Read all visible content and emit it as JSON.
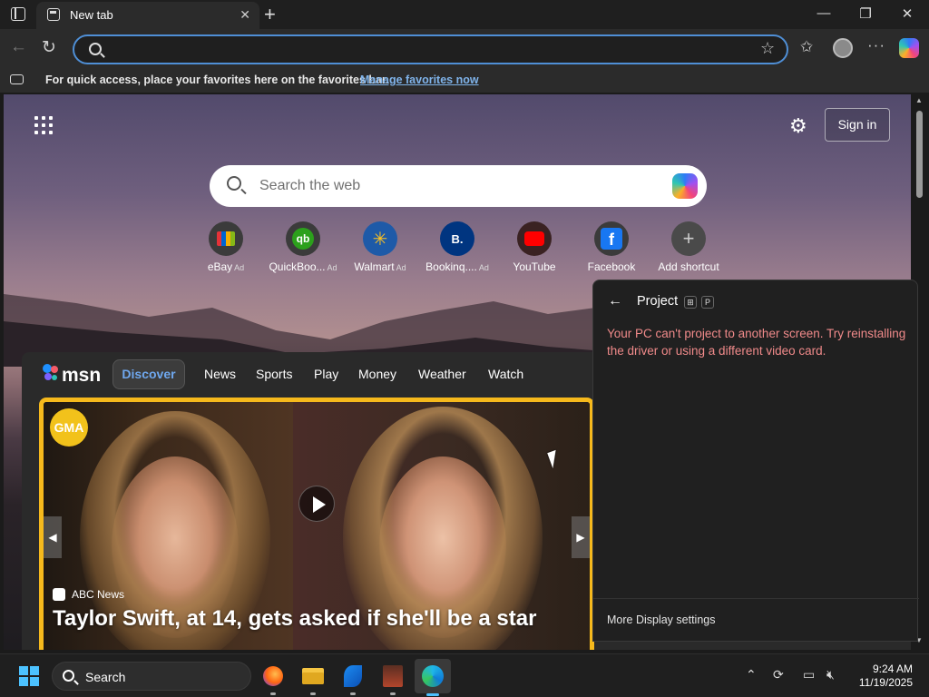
{
  "browser": {
    "tab_title": "New tab",
    "address_value": "",
    "favorites_bar": {
      "message": "For quick access, place your favorites here on the favorites bar.",
      "link": "Manage favorites now"
    }
  },
  "newtab": {
    "sign_in": "Sign in",
    "search_placeholder": "Search the web",
    "shortcuts": [
      {
        "label": "eBay",
        "ad": "Ad",
        "icon": "ebay-icon"
      },
      {
        "label": "QuickBoo...",
        "ad": "Ad",
        "icon": "quickbooks-icon"
      },
      {
        "label": "Walmart",
        "ad": "Ad",
        "icon": "walmart-icon"
      },
      {
        "label": "Bookinq....",
        "ad": "Ad",
        "icon": "booking-icon"
      },
      {
        "label": "YouTube",
        "ad": "",
        "icon": "youtube-icon"
      },
      {
        "label": "Facebook",
        "ad": "",
        "icon": "facebook-icon"
      },
      {
        "label": "Add shortcut",
        "ad": "",
        "icon": "plus-icon"
      }
    ]
  },
  "feed": {
    "logo": "msn",
    "nav": [
      "Discover",
      "News",
      "Sports",
      "Play",
      "Money",
      "Weather",
      "Watch"
    ],
    "card": {
      "badge": "GMA",
      "source": "ABC News",
      "headline": "Taylor Swift, at 14, gets asked if she'll be a star"
    }
  },
  "project_panel": {
    "title": "Project",
    "keys": [
      "⊞",
      "P"
    ],
    "error": "Your PC can't project to another screen. Try reinstalling the driver or using a different video card.",
    "footer": "More Display settings"
  },
  "taskbar": {
    "search_label": "Search",
    "time": "9:24 AM",
    "date": "11/19/2025"
  },
  "colors": {
    "accent": "#4f8fd6",
    "error_text": "#f08a8a",
    "card_border": "#f6b91c",
    "discover": "#6fa8ef"
  }
}
